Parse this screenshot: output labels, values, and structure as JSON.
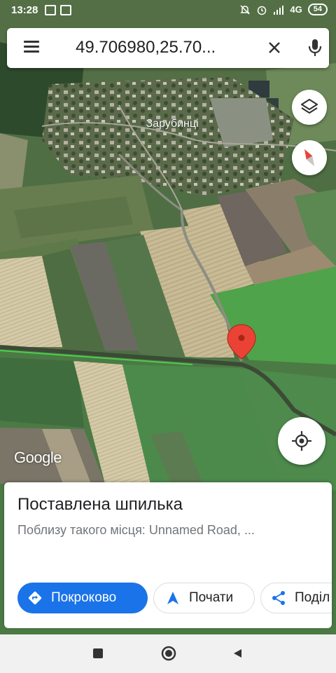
{
  "status_bar": {
    "time": "13:28",
    "network": "4G",
    "battery": "54"
  },
  "search": {
    "query": "49.706980,25.70..."
  },
  "map": {
    "village_label": "Зарубинці",
    "logo": "Google"
  },
  "place_card": {
    "title": "Поставлена шпилька",
    "subtitle": "Поблизу такого місця: Unnamed Road, ..."
  },
  "actions": {
    "directions": "Покроково",
    "start": "Почати",
    "share": "Поділ"
  },
  "colors": {
    "accent": "#1a73e8",
    "pin": "#ea4335",
    "route_highlight": "#4cd64c"
  },
  "icons": {
    "menu": "hamburger-icon",
    "clear": "close-icon",
    "mic": "mic-icon",
    "layers": "layers-icon",
    "compass": "compass-icon",
    "location": "my-location-icon",
    "directions": "directions-icon",
    "start": "navigation-arrow-icon",
    "share": "share-icon"
  }
}
